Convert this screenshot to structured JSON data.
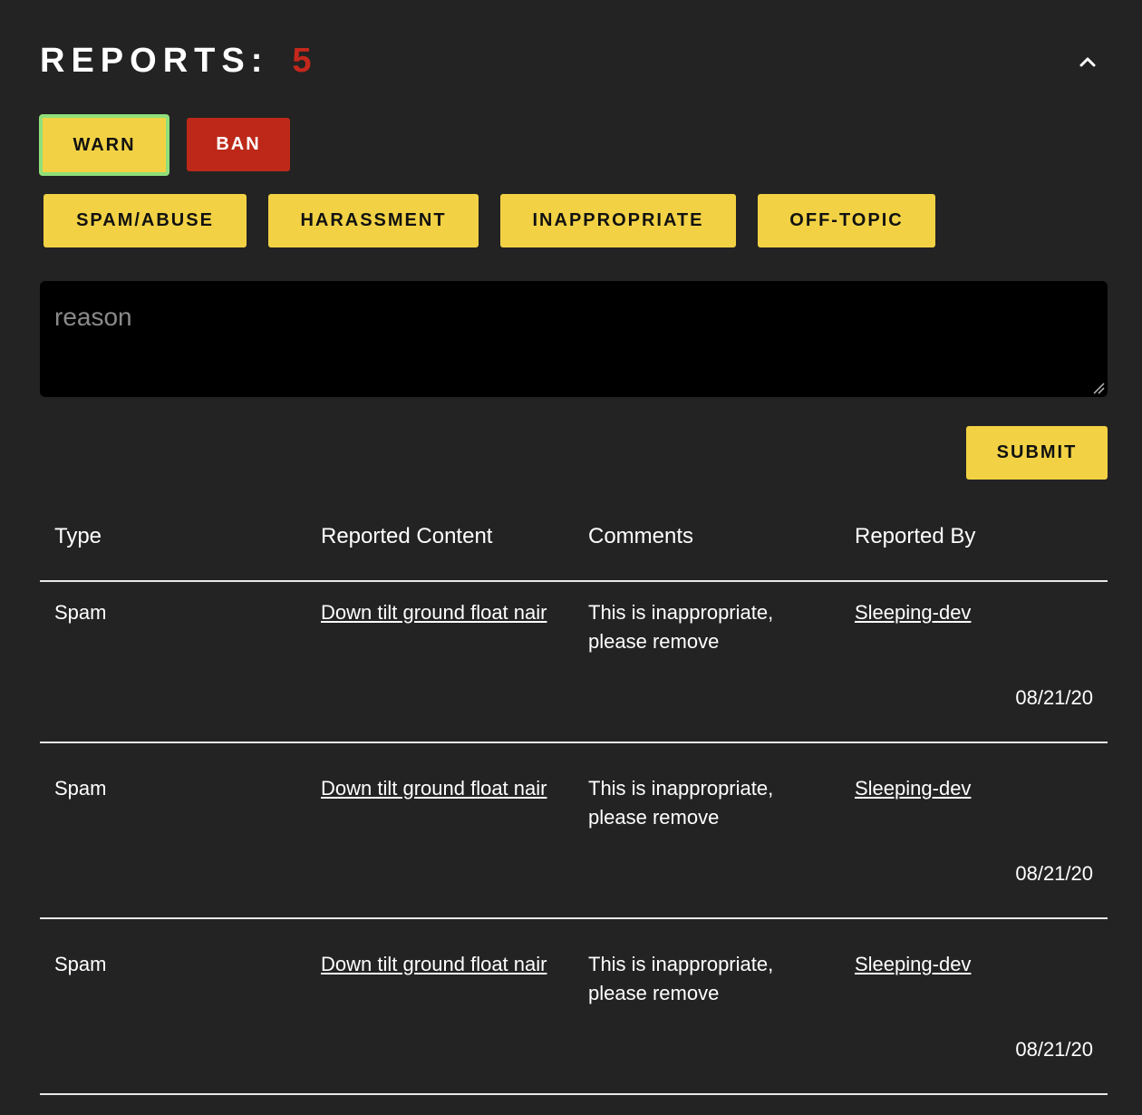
{
  "header": {
    "title": "REPORTS:",
    "count": "5"
  },
  "actions": {
    "warn_label": "WARN",
    "ban_label": "BAN"
  },
  "categories": [
    {
      "label": "SPAM/ABUSE"
    },
    {
      "label": "HARASSMENT"
    },
    {
      "label": "INAPPROPRIATE"
    },
    {
      "label": "OFF-TOPIC"
    }
  ],
  "reason": {
    "placeholder": "reason",
    "value": ""
  },
  "submit_label": "SUBMIT",
  "table": {
    "headers": [
      "Type",
      "Reported Content",
      "Comments",
      "Reported By"
    ],
    "rows": [
      {
        "type": "Spam",
        "content": "Down tilt ground float nair",
        "comment": "This is inappropriate, please remove",
        "reported_by": "Sleeping-dev",
        "date": "08/21/20"
      },
      {
        "type": "Spam",
        "content": "Down tilt ground float nair",
        "comment": "This is inappropriate, please remove",
        "reported_by": "Sleeping-dev",
        "date": "08/21/20"
      },
      {
        "type": "Spam",
        "content": "Down tilt ground float nair",
        "comment": "This is inappropriate, please remove",
        "reported_by": "Sleeping-dev",
        "date": "08/21/20"
      }
    ]
  },
  "colors": {
    "background": "#232323",
    "accent_yellow": "#f2d244",
    "accent_red": "#bd2818",
    "count_red": "#c4281c",
    "selected_outline": "#8fe07a"
  },
  "icons": {
    "collapse": "chevron-up-icon"
  }
}
